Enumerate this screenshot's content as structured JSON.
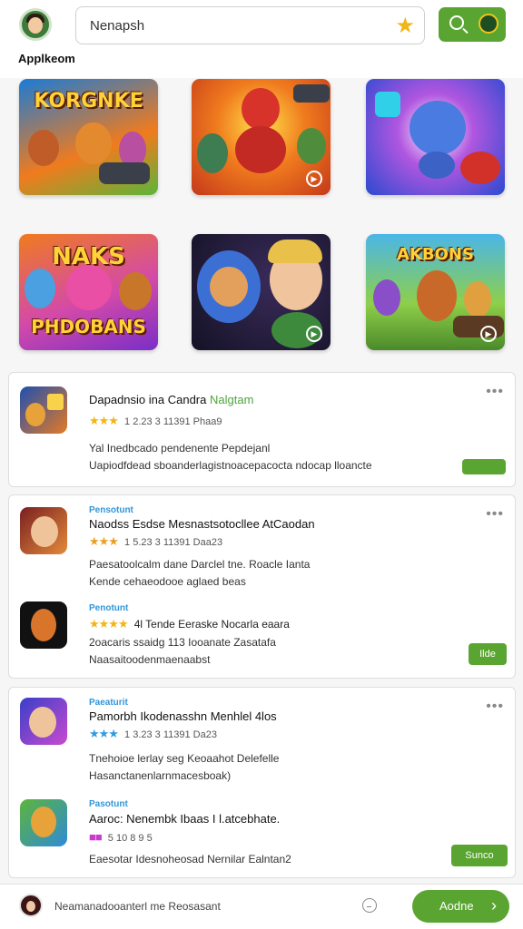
{
  "header": {
    "search_text": "Nenapsh",
    "section_title": "Applkeom"
  },
  "tiles": [
    {
      "text": "KORGNKE"
    },
    {
      "text": ""
    },
    {
      "text": ""
    },
    {
      "text": "NAKS"
    },
    {
      "text": ""
    },
    {
      "text": "AKBONS"
    }
  ],
  "cards": [
    {
      "items": [
        {
          "tag": "",
          "title": "Dapadnsio ina Candra",
          "title_suffix": "Nalgtam",
          "stars": "★★★",
          "rating": "1 2.23 3 11391 Phaa9",
          "desc1": "Yal Inedbcado pendenente Pepdejanl",
          "desc2": "Uapiodfdead sboanderlagistnoacepacocta ndocap lloancte"
        }
      ],
      "button": ""
    },
    {
      "items": [
        {
          "tag": "Pensotunt",
          "title": "Naodss Esdse Mesnastsotocllee AtCaodan",
          "title_suffix": "",
          "stars": "★★★",
          "rating": "1 5.23 3 11391 Daa23",
          "desc1": "Paesatoolcalm dane Darclel tne. Roacle Ianta",
          "desc2": "Kende cehaeodooe aglaed beas"
        },
        {
          "tag": "Penotunt",
          "title": "",
          "title_suffix": "",
          "stars": "★★★★",
          "rating": "4l Tende Eeraske Nocarla eaara",
          "desc1": "2oacaris ssaidg 113 Iooanate Zasatafa",
          "desc2": "Naasaitoodenmaenaabst"
        }
      ],
      "button": "Ilde"
    },
    {
      "items": [
        {
          "tag": "Paeaturit",
          "title": "Pamorbh Ikodenasshn Menhlel 4los",
          "title_suffix": "",
          "stars": "★★★",
          "rating": "1 3.23 3 11391 Da23",
          "desc1": "Tnehoioe lerlay seg Keoaahot Delefelle",
          "desc2": "Hasanctanenlarnmacesboak)"
        },
        {
          "tag": "Pasotunt",
          "title": "Aaroc: Nenembk Ibaas I l.atcebhate.",
          "title_suffix": "",
          "stars": "■■",
          "rating": "5 10 8 9 5",
          "desc1": "Eaesotar Idesnoheosad Nernilar Ealntan2",
          "desc2": ""
        }
      ],
      "button": "Sunco"
    }
  ],
  "bottom": {
    "text": "Neamanadooanterl me Reosasant",
    "button": "Aodne"
  },
  "colors": {
    "accent": "#5aa531",
    "tag": "#3296d8",
    "star": "#f2b516"
  }
}
